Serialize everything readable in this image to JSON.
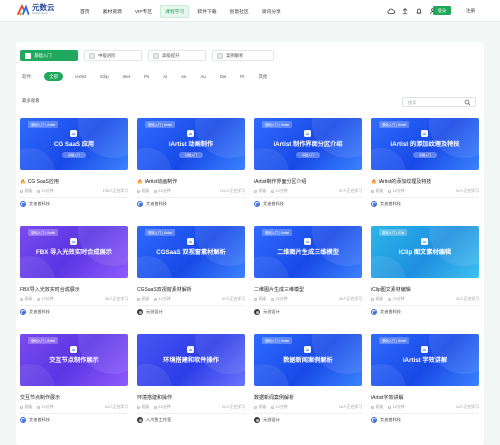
{
  "header": {
    "logo_cn": "元数云",
    "logo_en": "Shuzhi Cloud",
    "nav": [
      "首页",
      "素材资源",
      "VIP专区",
      "课程学习",
      "软件下载",
      "创意社区",
      "资讯分享"
    ],
    "active_nav": "课程学习",
    "login": "登录",
    "register": "注册"
  },
  "tabs": [
    "基础入门",
    "中级进阶",
    "高级提升",
    "案例解析"
  ],
  "filter": {
    "label": "软件：",
    "chips": [
      "全部",
      "iArtist",
      "iClip",
      "iSet",
      "Ps",
      "Ai",
      "Ae",
      "Au",
      "Dw",
      "Pr",
      "其他"
    ]
  },
  "sort_label": "最多观看",
  "search": {
    "placeholder": "搜索"
  },
  "cards": [
    {
      "tag": "基础入门 | iArtist",
      "thumb_title": "CG SaaS 应用",
      "pill": "基础入门",
      "title": "CG SaaS应用",
      "hot": true,
      "level": "初级",
      "duration": "12分钟",
      "learners": "135人正在学习",
      "author": "艾迪普科技",
      "theme": "g-blue"
    },
    {
      "tag": "基础入门 | iArtist",
      "thumb_title": "iArtist 动画制作",
      "pill": "基础入门",
      "title": "iArtist动画制作",
      "hot": true,
      "level": "初级",
      "duration": "12分钟",
      "learners": "121人正在学习",
      "author": "艾迪普科技",
      "theme": "g-blue"
    },
    {
      "tag": "基础入门 | iArtist",
      "thumb_title": "iArtist 制作界面分区介绍",
      "pill": "基础入门",
      "title": "iArtist制作界面分区介绍",
      "hot": false,
      "level": "初级",
      "duration": "12分钟",
      "learners": "97人正在学习",
      "author": "艾迪普科技",
      "theme": "g-blue"
    },
    {
      "tag": "基础入门 | iArtist",
      "thumb_title": "iArtist 的添加纹理及特技",
      "pill": "基础入门",
      "title": "iArtist的添加纹理及特技",
      "hot": true,
      "level": "初级",
      "duration": "12分钟",
      "learners": "91人正在学习",
      "author": "艾迪普科技",
      "theme": "g-blue"
    },
    {
      "tag": "基础入门 | iArtist",
      "thumb_title": "FBX 导入光效实时合成展示",
      "pill": "",
      "title": "FBX导入光效实时合成展示",
      "hot": false,
      "level": "初级",
      "duration": "12分钟",
      "learners": "46人正在学习",
      "author": "艾迪普科技",
      "theme": "g-purple"
    },
    {
      "tag": "基础入门 | iArtist",
      "thumb_title": "CGSaaS 双视窗素材解析",
      "pill": "",
      "title": "CGSaaS双视窗素材解析",
      "hot": false,
      "level": "初级",
      "duration": "12分钟",
      "learners": "37人正在学习",
      "author": "元创设计",
      "theme": "g-blue"
    },
    {
      "tag": "基础入门 | iArtist",
      "thumb_title": "二维图片生成三维模型",
      "pill": "",
      "title": "二维图片生成三维模型",
      "hot": false,
      "level": "初级",
      "duration": "12分钟",
      "learners": "35人正在学习",
      "author": "元创设计",
      "theme": "g-blue"
    },
    {
      "tag": "基础入门 | iClip",
      "thumb_title": "iClip 图文素材编辑",
      "pill": "",
      "title": "iClip图文素材编辑",
      "hot": false,
      "level": "初级",
      "duration": "12分钟",
      "learners": "32人正在学习",
      "author": "艾迪普科技",
      "theme": "g-cyan"
    },
    {
      "tag": "基础入门 | iArtist",
      "thumb_title": "交互节点制作展示",
      "pill": "",
      "title": "交互节点制作展示",
      "hot": false,
      "level": "初级",
      "duration": "12分钟",
      "learners": "24人正在学习",
      "author": "艾迪普科技",
      "theme": "g-purple"
    },
    {
      "tag": "",
      "thumb_title": "环境搭建和软件操作",
      "pill": "",
      "title": "环境搭建和操作",
      "hot": false,
      "level": "初级",
      "duration": "12分钟",
      "learners": "21人正在学习",
      "author": "八爪鱼工作室",
      "theme": "g-indigo"
    },
    {
      "tag": "基础入门 | iArtist",
      "thumb_title": "数据新闻案例解析",
      "pill": "",
      "title": "数据新闻案例解析",
      "hot": false,
      "level": "初级",
      "duration": "12分钟",
      "learners": "18人正在学习",
      "author": "元创设计",
      "theme": "g-blue"
    },
    {
      "tag": "基础入门 | iArtist",
      "thumb_title": "iArtist 字效讲解",
      "pill": "",
      "title": "iArtist字效讲解",
      "hot": false,
      "level": "初级",
      "duration": "12分钟",
      "learners": "14人正在学习",
      "author": "艾迪普科技",
      "theme": "g-blue"
    }
  ],
  "colors": {
    "accent": "#20a95d",
    "hot": "#ff6b2c"
  }
}
